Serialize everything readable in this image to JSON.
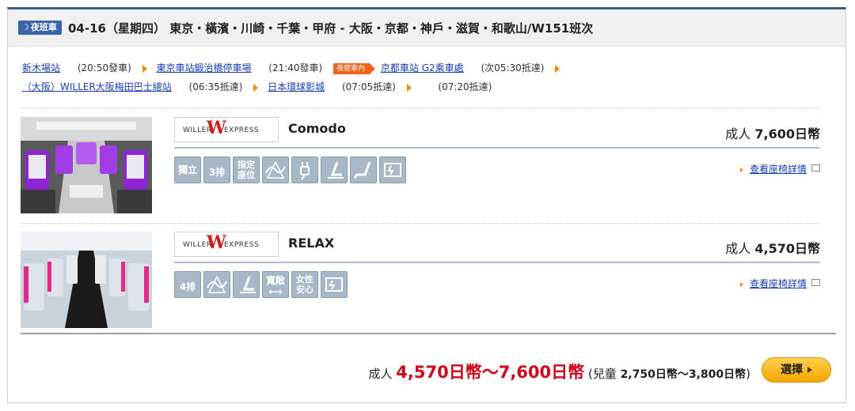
{
  "header": {
    "badge": "夜班車",
    "title": "04-16（星期四） 東京・橫濱・川崎・千葉・甲府 - 大阪・京都・神戶・滋賀・和歌山/W151班次"
  },
  "route": {
    "line1": [
      {
        "kind": "link",
        "text": "新木場站"
      },
      {
        "kind": "time",
        "text": "(20:50發車)"
      },
      {
        "kind": "link",
        "text": "東京車站鍛治橋停車場"
      },
      {
        "kind": "time",
        "text": "(21:40發車)"
      },
      {
        "kind": "tag",
        "text": "夜宿車內"
      },
      {
        "kind": "link",
        "text": "京都車站 G2乘車處"
      },
      {
        "kind": "time",
        "text": "(次05:30抵達)"
      }
    ],
    "line2": [
      {
        "kind": "link",
        "text": "（大阪）WILLER大阪梅田巴士總站"
      },
      {
        "kind": "time",
        "text": "(06:35抵達)"
      },
      {
        "kind": "link",
        "text": "日本環球影城"
      },
      {
        "kind": "time",
        "text": "(07:05抵達)"
      },
      {
        "kind": "time",
        "text": "(07:20抵達)"
      }
    ]
  },
  "buses": [
    {
      "logo_willer": "WILLER",
      "logo_w": "W",
      "logo_express": "EXPRESS",
      "name": "Comodo",
      "price_label": "成人",
      "price_value": "7,600日幣",
      "detail_link": "查看座椅詳情",
      "icons": [
        {
          "name": "independent-seat-icon",
          "text": "獨立"
        },
        {
          "name": "three-row-icon",
          "text": "3排"
        },
        {
          "name": "reserved-seat-icon",
          "text": "指定座位"
        },
        {
          "name": "curtain-icon",
          "text": ""
        },
        {
          "name": "power-plug-icon",
          "text": ""
        },
        {
          "name": "reclining-seat-icon",
          "text": ""
        },
        {
          "name": "leg-rest-icon",
          "text": ""
        },
        {
          "name": "toilet-icon",
          "text": ""
        }
      ]
    },
    {
      "logo_willer": "WILLER",
      "logo_w": "W",
      "logo_express": "EXPRESS",
      "name": "RELAX",
      "price_label": "成人",
      "price_value": "4,570日幣",
      "detail_link": "查看座椅詳情",
      "icons": [
        {
          "name": "four-row-icon",
          "text": "4排"
        },
        {
          "name": "curtain-icon",
          "text": ""
        },
        {
          "name": "reclining-seat-icon",
          "text": ""
        },
        {
          "name": "wide-seat-icon",
          "text": "寬敞"
        },
        {
          "name": "women-safe-icon",
          "text": "女性安心"
        },
        {
          "name": "toilet-icon",
          "text": ""
        }
      ]
    }
  ],
  "total": {
    "adult_label": "成人",
    "adult_range": "4,570日幣～7,600日幣",
    "child_open": "(兒童 ",
    "child_range": "2,750日幣～3,800日幣",
    "child_close": ")"
  },
  "select_button": "選擇",
  "colors": {
    "accent": "#3b5f8f",
    "price_red": "#d0021b",
    "link_blue": "#1a3fb0",
    "orange": "#f08a00",
    "button_yellow": "#f5a600"
  }
}
